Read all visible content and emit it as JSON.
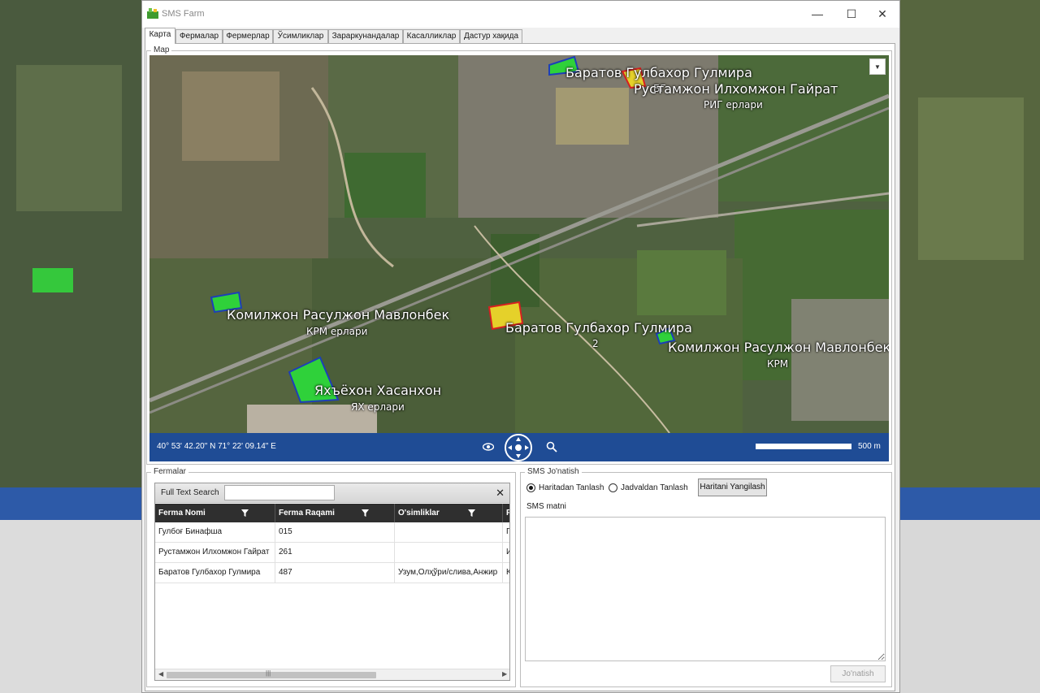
{
  "window": {
    "title": "SMS Farm",
    "controls": {
      "minimize": "—",
      "maximize": "☐",
      "close": "✕"
    }
  },
  "tabs": [
    "Карта",
    "Фермалар",
    "Фермерлар",
    "Ўсимликлар",
    "Зараркунандалар",
    "Касалликлар",
    "Дастур хақида"
  ],
  "active_tab": "Карта",
  "map": {
    "group_title": "Map",
    "labels": [
      {
        "name": "Баратов Гулбахор Гулмира"
      },
      {
        "name": "Рустамжон Илхомжон Гайрат",
        "sub": "РИГ ерлари"
      },
      {
        "name": "Комилжон Расулжон Мавлонбек",
        "sub": "КРМ ерлари"
      },
      {
        "name": "Баратов Гулбахор Гулмира",
        "sub": "2"
      },
      {
        "name": "Комилжон Расулжон Мавлонбек",
        "sub": "КРМ"
      },
      {
        "name": "Яхъёхон Хасанхон",
        "sub": "ЯХ ерлари"
      }
    ],
    "partial_label": "БГ",
    "coordinates": "40° 53' 42.20\" N 71° 22' 09.14\" E",
    "scale": "500 m",
    "dropdown_symbol": "▼"
  },
  "fermalar": {
    "group_title": "Fermalar",
    "search_label": "Full Text Search",
    "search_value": "",
    "close_symbol": "✕",
    "columns": [
      "Ferma Nomi",
      "Ferma Raqami",
      "O'simliklar",
      "Fe"
    ],
    "rows": [
      [
        "Гулбоғ Бинафша",
        "015",
        "",
        "Гу"
      ],
      [
        "Рустамжон Илхомжон Гайрат",
        "261",
        "",
        "И"
      ],
      [
        "Баратов Гулбахор Гулмира",
        "487",
        "Узум,Олҳўри/слива,Анжир",
        "Ко"
      ]
    ],
    "scroll_left": "◀",
    "scroll_right": "▶",
    "scroll_grip": "|||"
  },
  "sms": {
    "group_title": "SMS Jo'natish",
    "option_map": "Haritadan Tanlash",
    "option_table": "Jadvaldan Tanlash",
    "selected_option": "Haritadan Tanlash",
    "refresh_button": "Haritani Yangilash",
    "text_label": "SMS matni",
    "text_value": "",
    "send_button": "Jo'natish"
  },
  "colors": {
    "status_bar": "#1f4c95",
    "field_green": "#2fd13a",
    "field_yellow": "#e5d12a",
    "field_border_blue": "#1d3fb8",
    "field_border_red": "#d62020"
  }
}
